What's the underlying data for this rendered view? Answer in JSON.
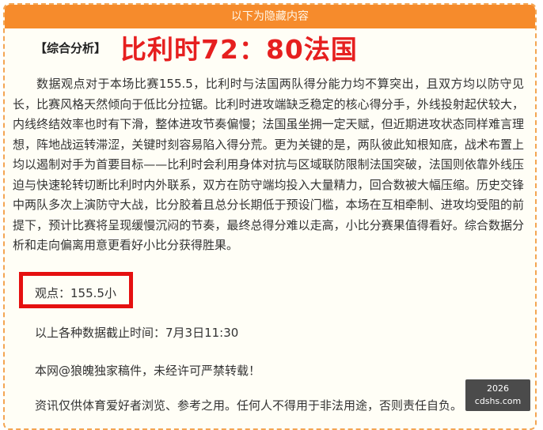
{
  "banner": {
    "text": "以下为隐藏内容"
  },
  "headline": {
    "tag": "【综合分析】",
    "title": "比利时72：80法国"
  },
  "analysis": {
    "paragraph": "数据观点对于本场比赛155.5，比利时与法国两队得分能力均不算突出，且双方均以防守见长，比赛风格天然倾向于低比分拉锯。比利时进攻端缺乏稳定的核心得分手，外线投射起伏较大，内线终结效率也时有下滑，整体进攻节奏偏慢；法国虽坐拥一定天赋，但近期进攻状态同样难言理想，阵地战运转滞涩，关键时刻容易陷入得分荒。更为关键的是，两队彼此知根知底，战术布置上均以遏制对手为首要目标——比利时会利用身体对抗与区域联防限制法国突破，法国则依靠外线压迫与快速轮转切断比利时内外联系，双方在防守端均投入大量精力，回合数被大幅压缩。历史交锋中两队多次上演防守大战，比分胶着且总分长期低于预设门槛，本场在互相牵制、进攻均受阻的前提下，预计比赛将呈现缓慢沉闷的节奏，最终总得分难以走高，小比分赛果值得看好。综合数据分析和走向偏离用意更看好小比分获得胜果。"
  },
  "viewpoint": {
    "text": "观点：155.5小"
  },
  "cutoff": {
    "text": "以上各种数据截止时间：7月3日11:30"
  },
  "copyright": {
    "text": "本网@狼魄独家稿件，未经许可严禁转载！"
  },
  "disclaimer": {
    "text": "资讯仅供体育爱好者浏览、参考之用。任何人不得用于非法用途，否则责任自负。"
  },
  "watermark": {
    "line1": "2026",
    "line2": "cdshs.com"
  },
  "colors": {
    "banner": "#f68b2c",
    "title_red": "#e61f1f",
    "highlight_box": "#e51010",
    "panel_border": "#f4a552"
  }
}
